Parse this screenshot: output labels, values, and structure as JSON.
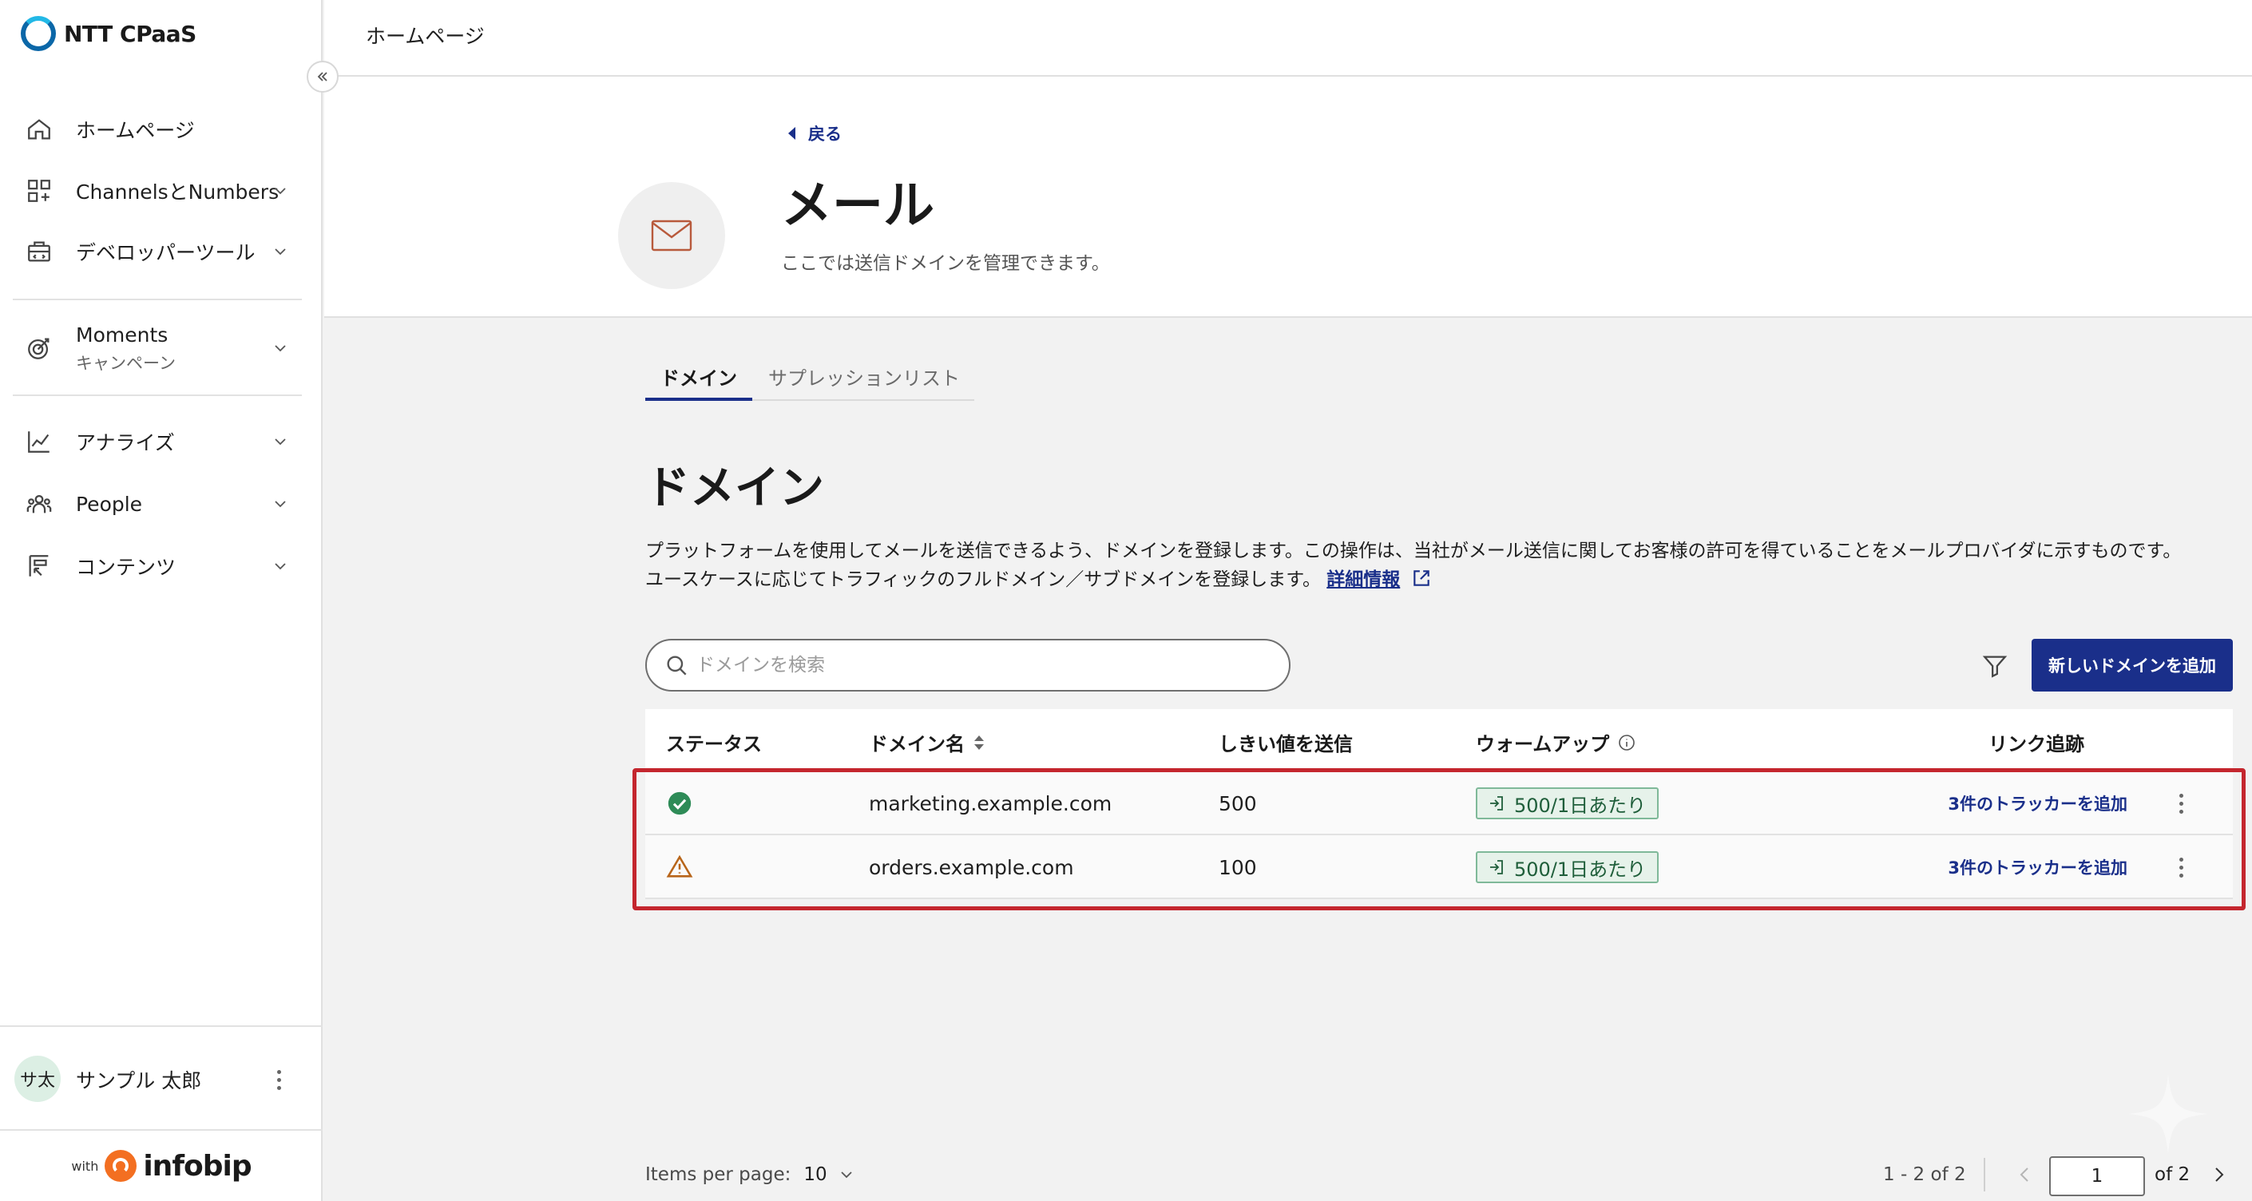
{
  "brand": {
    "name": "NTT CPaaS"
  },
  "sidebar": {
    "items": [
      {
        "label": "ホームページ",
        "icon": "home-icon"
      },
      {
        "label": "ChannelsとNumbers",
        "icon": "grid-plus-icon"
      },
      {
        "label": "デベロッパーツール",
        "icon": "toolbox-icon"
      },
      {
        "label": "Moments",
        "sublabel": "キャンペーン",
        "icon": "target-icon"
      },
      {
        "label": "アナライズ",
        "icon": "chart-line-icon"
      },
      {
        "label": "People",
        "icon": "people-icon"
      },
      {
        "label": "コンテンツ",
        "icon": "content-icon"
      }
    ],
    "user": {
      "initials": "サ太",
      "name": "サンプル 太郎"
    },
    "powered": {
      "with": "with",
      "logo_text": "infobip"
    }
  },
  "topbar": {
    "title": "ホームページ"
  },
  "header": {
    "back_label": "戻る",
    "title": "メール",
    "subtitle": "ここでは送信ドメインを管理できます。"
  },
  "tabs": [
    {
      "label": "ドメイン",
      "active": true
    },
    {
      "label": "サプレッションリスト",
      "active": false
    }
  ],
  "section": {
    "title": "ドメイン",
    "description_line1": "プラットフォームを使用してメールを送信できるよう、ドメインを登録します。この操作は、当社がメール送信に関してお客様の許可を得ていることをメールプロバイダに示すものです。",
    "description_line2": "ユースケースに応じてトラフィックのフルドメイン／サブドメインを登録します。",
    "more_link": "詳細情報"
  },
  "search": {
    "placeholder": "ドメインを検索",
    "value": ""
  },
  "add_button": "新しいドメインを追加",
  "table": {
    "headers": {
      "status": "ステータス",
      "domain": "ドメイン名",
      "threshold": "しきい値を送信",
      "warmup": "ウォームアップ",
      "tracking": "リンク追跡"
    },
    "rows": [
      {
        "status": "verified",
        "domain": "marketing.example.com",
        "threshold": "500",
        "warmup": "500/1日あたり",
        "tracking": "3件のトラッカーを追加"
      },
      {
        "status": "warning",
        "domain": "orders.example.com",
        "threshold": "100",
        "warmup": "500/1日あたり",
        "tracking": "3件のトラッカーを追加"
      }
    ]
  },
  "pagination": {
    "items_per_page_label": "Items per page:",
    "items_per_page": "10",
    "range": "1 - 2 of 2",
    "current_page": "1",
    "of_pages": "of 2"
  },
  "colors": {
    "accent": "#1a2f8a",
    "success": "#2e8b57",
    "warning": "#b8651a",
    "highlight": "#c4262e"
  }
}
